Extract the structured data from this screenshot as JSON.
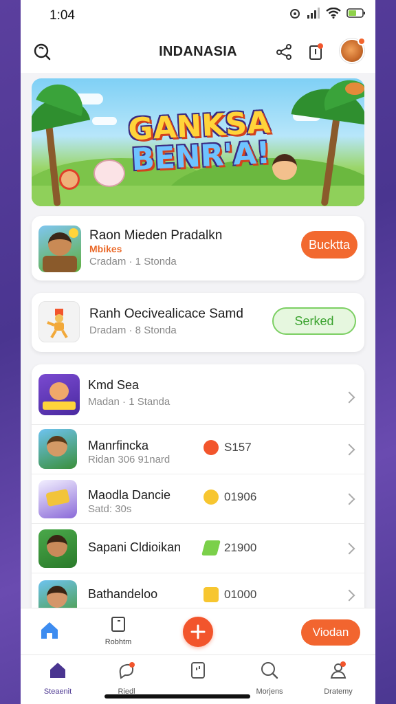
{
  "status_bar": {
    "time": "1:04"
  },
  "header": {
    "title": "INDANASIA"
  },
  "banner": {
    "title_line1": "GANKSA",
    "title_line2": "BENR'A!"
  },
  "featured": [
    {
      "title": "Raon Mieden Pradalkn",
      "tag": "Mbikes",
      "subtitle": "Cradam · 1 Stonda",
      "button": "Bucktta"
    },
    {
      "title": "Ranh Oecivealicace Samd",
      "subtitle": "Dradam · 8 Stonda",
      "button": "Serked"
    }
  ],
  "list": [
    {
      "title": "Kmd Sea",
      "subtitle": "Madan · 1 Standa",
      "value": ""
    },
    {
      "title": "Manrfincka",
      "subtitle": "Ridan 306 91nard",
      "value": "S157"
    },
    {
      "title": "Maodla Dancie",
      "subtitle": "Satd: 30s",
      "value": "01906"
    },
    {
      "title": "Sapani Cldioikan",
      "subtitle": "",
      "value": "21900"
    },
    {
      "title": "Bathandeloo",
      "subtitle": "",
      "value": "01000"
    }
  ],
  "actionbar": {
    "left_label": "Robhtm",
    "right_button": "Viodan"
  },
  "tabs": [
    {
      "label": "Steaenit"
    },
    {
      "label": "Riedl"
    },
    {
      "label": ""
    },
    {
      "label": "Morjens"
    },
    {
      "label": "Dratemy"
    }
  ],
  "colors": {
    "accent": "#f2652f",
    "brand_purple": "#4a3590",
    "success": "#3aa22e"
  }
}
